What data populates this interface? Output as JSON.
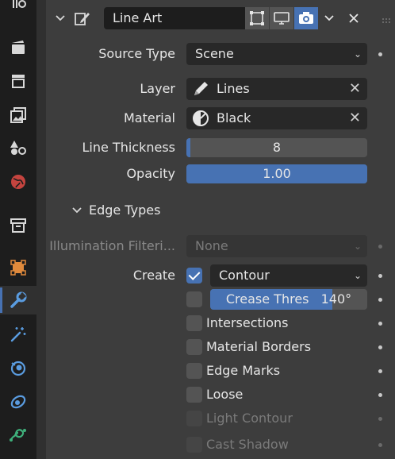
{
  "modifier": {
    "name": "Line Art",
    "colors": {
      "accent": "#4772b3",
      "panel": "#3d3d3d",
      "field": "#282828",
      "button": "#545454"
    }
  },
  "properties": {
    "source_type": {
      "label": "Source Type",
      "value": "Scene"
    },
    "layer": {
      "label": "Layer",
      "value": "Lines",
      "icon": "pencil-icon"
    },
    "material": {
      "label": "Material",
      "value": "Black",
      "icon": "material-sphere-icon"
    },
    "line_thickness": {
      "label": "Line Thickness",
      "value": "8",
      "fill_fraction": 0.02
    },
    "opacity": {
      "label": "Opacity",
      "value": "1.00",
      "fill_fraction": 1.0
    }
  },
  "edge_types": {
    "title": "Edge Types",
    "illumination_filtering": {
      "label": "Illumination Filteri...",
      "value": "None"
    },
    "create": {
      "label": "Create",
      "checked": true,
      "value": "Contour"
    },
    "crease_threshold": {
      "checked": false,
      "label": "Crease Thres",
      "value": "140°",
      "fill_fraction": 0.78
    },
    "checkboxes": [
      {
        "label": "Intersections",
        "checked": false,
        "enabled": true
      },
      {
        "label": "Material Borders",
        "checked": false,
        "enabled": true
      },
      {
        "label": "Edge Marks",
        "checked": false,
        "enabled": true
      },
      {
        "label": "Loose",
        "checked": false,
        "enabled": true
      },
      {
        "label": "Light Contour",
        "checked": false,
        "enabled": false
      },
      {
        "label": "Cast Shadow",
        "checked": false,
        "enabled": false
      }
    ]
  },
  "tabs": [
    "tool-icon",
    "render-icon",
    "output-icon",
    "view-layer-icon",
    "scene-icon",
    "world-icon",
    "collection-icon",
    "object-icon",
    "modifier-icon",
    "effects-icon",
    "physics-icon",
    "constraints-icon",
    "data-icon"
  ]
}
